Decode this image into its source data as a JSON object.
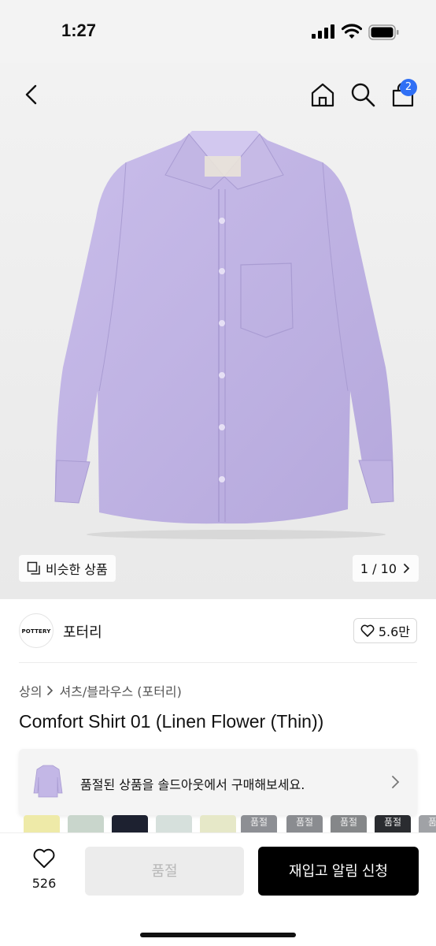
{
  "status_bar": {
    "time": "1:27"
  },
  "nav": {
    "cart_count": "2"
  },
  "gallery": {
    "similar_label": "비슷한 상품",
    "page_indicator": "1 / 10"
  },
  "brand": {
    "logo_text": "POTTERY",
    "name": "포터리",
    "likes": "5.6만"
  },
  "breadcrumb": {
    "level1": "상의",
    "level2": "셔츠/블라우스 (포터리)"
  },
  "product": {
    "title": "Comfort Shirt 01 (Linen Flower (Thin))"
  },
  "soldout_banner": {
    "text": "품절된 상품을 솔드아웃에서 구매해보세요."
  },
  "swatches": [
    {
      "color": "#eeeaa8",
      "label": ""
    },
    {
      "color": "#c9d6cc",
      "label": ""
    },
    {
      "color": "#1d2130",
      "label": ""
    },
    {
      "color": "#d6e0dc",
      "label": ""
    },
    {
      "color": "#e6e8c8",
      "label": ""
    },
    {
      "color": "#8d8f94",
      "label": "품절"
    },
    {
      "color": "#8a8c90",
      "label": "품절"
    },
    {
      "color": "#858789",
      "label": "품절"
    },
    {
      "color": "#2a2c30",
      "label": "품절"
    },
    {
      "color": "#a0a2a6",
      "label": "품"
    }
  ],
  "bottom_bar": {
    "wish_count": "526",
    "soldout_label": "품절",
    "restock_label": "재입고 알림 신청"
  },
  "colors": {
    "shirt": "#c3b7e6",
    "badge": "#2f6ff5",
    "cta": "#000000"
  }
}
